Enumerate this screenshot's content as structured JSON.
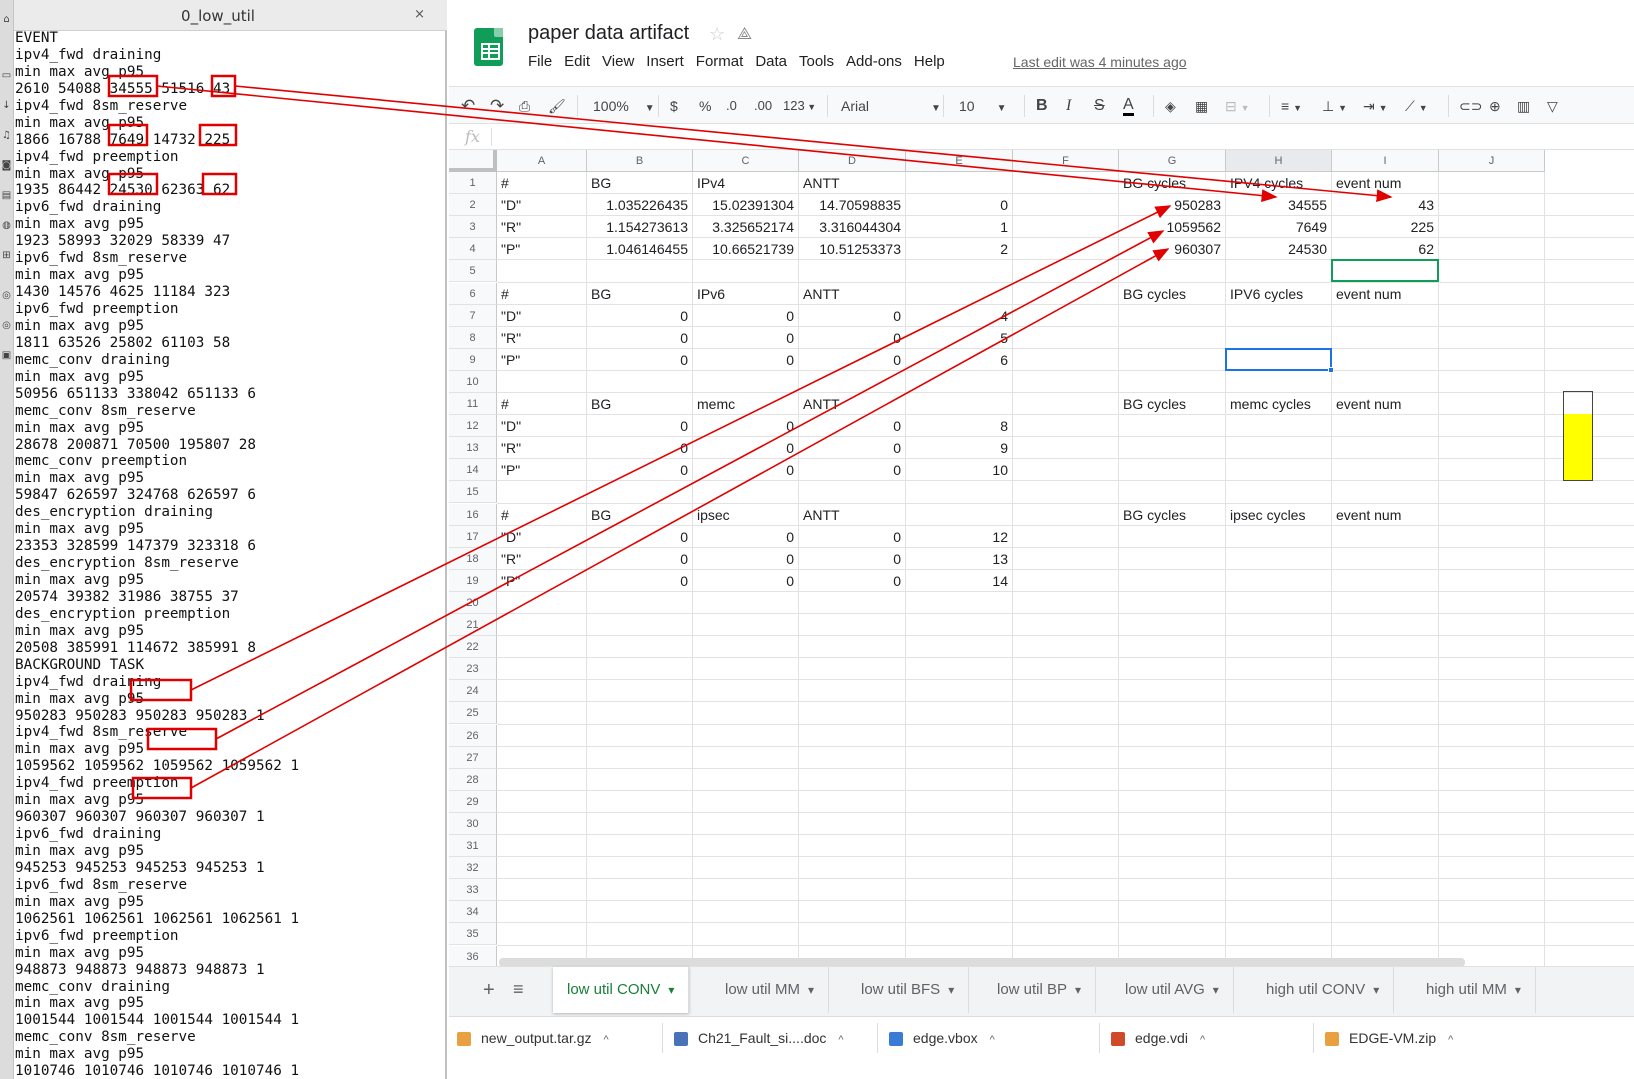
{
  "editor": {
    "tab_title": "0_low_util",
    "close_glyph": "×",
    "lines": [
      "EVENT",
      "ipv4_fwd draining",
      "min max avg p95",
      "2610 54088 34555 51516 43",
      "ipv4_fwd 8sm_reserve",
      "min max avg p95",
      "1866 16788 7649 14732 225",
      "ipv4_fwd preemption",
      "min max avg p95",
      "1935 86442 24530 62363 62",
      "ipv6_fwd draining",
      "min max avg p95",
      "1923 58993 32029 58339 47",
      "ipv6_fwd 8sm_reserve",
      "min max avg p95",
      "1430 14576 4625 11184 323",
      "ipv6_fwd preemption",
      "min max avg p95",
      "1811 63526 25802 61103 58",
      "memc_conv draining",
      "min max avg p95",
      "50956 651133 338042 651133 6",
      "memc_conv 8sm_reserve",
      "min max avg p95",
      "28678 200871 70500 195807 28",
      "memc_conv preemption",
      "min max avg p95",
      "59847 626597 324768 626597 6",
      "des_encryption draining",
      "min max avg p95",
      "23353 328599 147379 323318 6",
      "des_encryption 8sm_reserve",
      "min max avg p95",
      "20574 39382 31986 38755 37",
      "des_encryption preemption",
      "min max avg p95",
      "20508 385991 114672 385991 8",
      "BACKGROUND TASK",
      "ipv4_fwd draining",
      "min max avg p95",
      "950283 950283 950283 950283 1",
      "ipv4_fwd 8sm_reserve",
      "min max avg p95",
      "1059562 1059562 1059562 1059562 1",
      "ipv4_fwd preemption",
      "min max avg p95",
      "960307 960307 960307 960307 1",
      "ipv6_fwd draining",
      "min max avg p95",
      "945253 945253 945253 945253 1",
      "ipv6_fwd 8sm_reserve",
      "min max avg p95",
      "1062561 1062561 1062561 1062561 1",
      "ipv6_fwd preemption",
      "min max avg p95",
      "948873 948873 948873 948873 1",
      "memc_conv draining",
      "min max avg p95",
      "1001544 1001544 1001544 1001544 1",
      "memc_conv 8sm_reserve",
      "min max avg p95",
      "1010746 1010746 1010746 1010746 1"
    ]
  },
  "sheets": {
    "title": "paper data artifact",
    "star_glyph": "☆",
    "drive_glyph": "⟁",
    "menu": [
      "File",
      "Edit",
      "View",
      "Insert",
      "Format",
      "Data",
      "Tools",
      "Add-ons",
      "Help"
    ],
    "last_edit": "Last edit was 4 minutes ago",
    "toolbar": {
      "zoom": "100%",
      "currency": "$",
      "percent": "%",
      "dec_less": ".0",
      "dec_more": ".00",
      "format_more": "123",
      "font": "Arial",
      "font_size": "10",
      "bold": "B",
      "italic": "I",
      "strike": "S",
      "text_color": "A"
    },
    "fx": "fx",
    "columns": [
      "A",
      "B",
      "C",
      "D",
      "E",
      "F",
      "G",
      "H",
      "I",
      "J"
    ],
    "selected_column": "H",
    "row_numbers": [
      "1",
      "2",
      "3",
      "4",
      "5",
      "6",
      "7",
      "8",
      "9",
      "10",
      "11",
      "12",
      "13",
      "14",
      "15",
      "16",
      "17",
      "18",
      "19",
      "20",
      "21",
      "22",
      "23",
      "24",
      "25",
      "26",
      "27",
      "28",
      "29",
      "30",
      "31",
      "32",
      "33",
      "34",
      "35",
      "36"
    ],
    "rows": [
      [
        "#",
        "BG",
        "IPv4",
        "ANTT",
        "",
        "",
        "BG cycles",
        "IPV4 cycles",
        "event num"
      ],
      [
        "\"D\"",
        "1.035226435",
        "15.02391304",
        "14.70598835",
        "0",
        "",
        "950283",
        "34555",
        "43"
      ],
      [
        "\"R\"",
        "1.154273613",
        "3.325652174",
        "3.316044304",
        "1",
        "",
        "1059562",
        "7649",
        "225"
      ],
      [
        "\"P\"",
        "1.046146455",
        "10.66521739",
        "10.51253373",
        "2",
        "",
        "960307",
        "24530",
        "62"
      ],
      [
        "",
        "",
        "",
        "",
        "",
        "",
        "",
        "",
        ""
      ],
      [
        "#",
        "BG",
        "IPv6",
        "ANTT",
        "",
        "",
        "BG cycles",
        "IPV6 cycles",
        "event num"
      ],
      [
        "\"D\"",
        "0",
        "0",
        "0",
        "4",
        "",
        "",
        "",
        ""
      ],
      [
        "\"R\"",
        "0",
        "0",
        "0",
        "5",
        "",
        "",
        "",
        ""
      ],
      [
        "\"P\"",
        "0",
        "0",
        "0",
        "6",
        "",
        "",
        "",
        ""
      ],
      [
        "",
        "",
        "",
        "",
        "",
        "",
        "",
        "",
        ""
      ],
      [
        "#",
        "BG",
        "memc",
        "ANTT",
        "",
        "",
        "BG cycles",
        "memc cycles",
        "event num"
      ],
      [
        "\"D\"",
        "0",
        "0",
        "0",
        "8",
        "",
        "",
        "",
        ""
      ],
      [
        "\"R\"",
        "0",
        "0",
        "0",
        "9",
        "",
        "",
        "",
        ""
      ],
      [
        "\"P\"",
        "0",
        "0",
        "0",
        "10",
        "",
        "",
        "",
        ""
      ],
      [
        "",
        "",
        "",
        "",
        "",
        "",
        "",
        "",
        ""
      ],
      [
        "#",
        "BG",
        "ipsec",
        "ANTT",
        "",
        "",
        "BG cycles",
        "ipsec cycles",
        "event num"
      ],
      [
        "\"D\"",
        "0",
        "0",
        "0",
        "12",
        "",
        "",
        "",
        ""
      ],
      [
        "\"R\"",
        "0",
        "0",
        "0",
        "13",
        "",
        "",
        "",
        ""
      ],
      [
        "\"P\"",
        "0",
        "0",
        "0",
        "14",
        "",
        "",
        "",
        ""
      ]
    ],
    "sheet_tabs": [
      "low util CONV",
      "low util MM",
      "low util BFS",
      "low util BP",
      "low util AVG",
      "high util CONV",
      "high util MM"
    ],
    "active_tab": "low util CONV",
    "add_glyph": "+",
    "list_glyph": "≡",
    "caret_glyph": "▾"
  },
  "downloads": [
    "new_output.tar.gz",
    "Ch21_Fault_si....doc",
    "edge.vbox",
    "edge.vdi",
    "EDGE-VM.zip"
  ],
  "colors": {
    "annotation_red": "#e00000",
    "sheets_green": "#0f9d58",
    "active_tab_green": "#188038",
    "selection_blue": "#1a73e8",
    "highlight_yellow": "#ffff00"
  }
}
